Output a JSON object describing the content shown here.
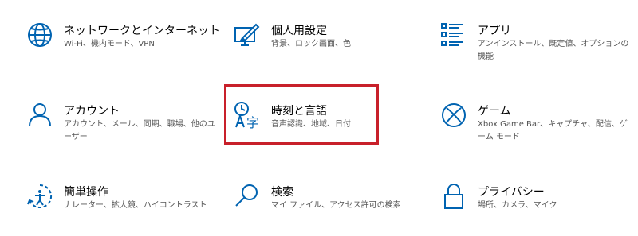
{
  "accent_color": "#0063b1",
  "highlight_color": "#c8202a",
  "tiles": [
    {
      "icon": "globe-icon",
      "title": "ネットワークとインターネット",
      "desc": "Wi-Fi、機内モード、VPN"
    },
    {
      "icon": "personalization-icon",
      "title": "個人用設定",
      "desc": "背景、ロック画面、色"
    },
    {
      "icon": "apps-icon",
      "title": "アプリ",
      "desc": "アンインストール、既定値、オプションの機能"
    },
    {
      "icon": "account-icon",
      "title": "アカウント",
      "desc": "アカウント、メール、同期、職場、他のユーザー"
    },
    {
      "icon": "time-language-icon",
      "title": "時刻と言語",
      "desc": "音声認識、地域、日付"
    },
    {
      "icon": "xbox-icon",
      "title": "ゲーム",
      "desc": "Xbox Game Bar、キャプチャ、配信、ゲーム モード"
    },
    {
      "icon": "ease-of-access-icon",
      "title": "簡単操作",
      "desc": "ナレーター、拡大鏡、ハイコントラスト"
    },
    {
      "icon": "search-icon",
      "title": "検索",
      "desc": "マイ ファイル、アクセス許可の検索"
    },
    {
      "icon": "lock-icon",
      "title": "プライバシー",
      "desc": "場所、カメラ、マイク"
    }
  ]
}
